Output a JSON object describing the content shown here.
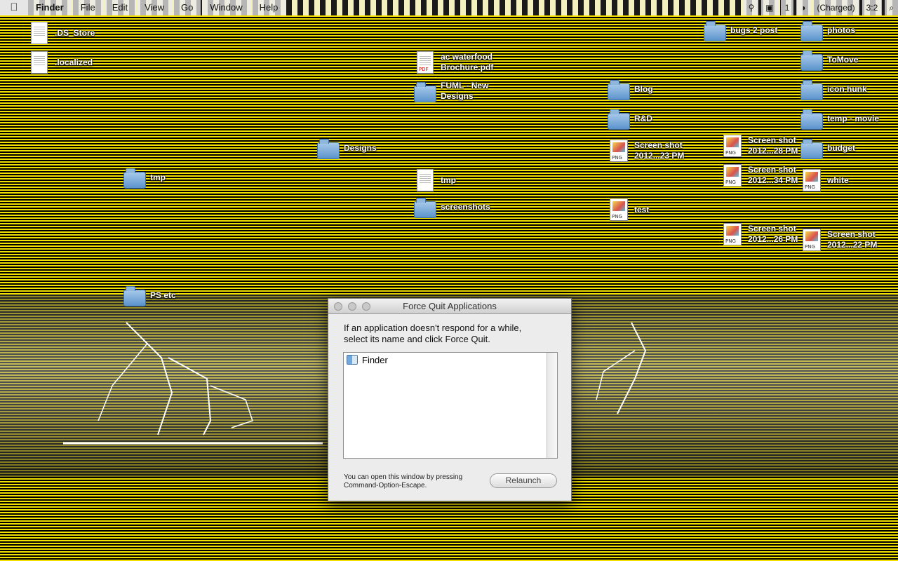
{
  "menubar": {
    "apple_icon": "apple-icon",
    "items": [
      "Finder",
      "File",
      "Edit",
      "View",
      "Go",
      "Window",
      "Help"
    ],
    "status": {
      "keyboard": "1",
      "battery": "(Charged)",
      "clock": "3:2"
    }
  },
  "desktop_icons": {
    "ds_store": {
      "label": ".DS_Store"
    },
    "localized": {
      "label": ".localized"
    },
    "brochure": {
      "line1": "ac waterfood",
      "line2": "Brochure.pdf"
    },
    "new_designs": {
      "line1": "FUML - New",
      "line2": "Designs"
    },
    "designs": {
      "label": "Designs"
    },
    "tmp_left": {
      "label": "tmp"
    },
    "tmp_doc": {
      "label": "tmp"
    },
    "screenshots": {
      "label": "screenshots"
    },
    "ps_etc": {
      "label": "PS etc"
    },
    "blog": {
      "label": "Blog"
    },
    "rnd": {
      "label": "R&D"
    },
    "screenshot_a": {
      "line1": "Screen shot",
      "line2": "2012...23 PM"
    },
    "test": {
      "label": "test"
    },
    "bugs": {
      "label": "bugs 2 post"
    },
    "screenshot_b": {
      "line1": "Screen shot",
      "line2": "2012...28 PM"
    },
    "screenshot_c": {
      "line1": "Screen shot",
      "line2": "2012...34 PM"
    },
    "screenshot_d": {
      "line1": "Screen shot",
      "line2": "2012...26 PM"
    },
    "photos": {
      "label": "photos"
    },
    "tomove": {
      "label": "ToMove"
    },
    "icon_hunk": {
      "label": "icon hunk"
    },
    "temp_movie": {
      "label": "temp - movie"
    },
    "budget": {
      "label": "budget"
    },
    "white": {
      "label": "white"
    },
    "screenshot_e": {
      "line1": "Screen shot",
      "line2": "2012...22 PM"
    }
  },
  "force_quit": {
    "title": "Force Quit Applications",
    "intro_line1": "If an application doesn't respond for a while,",
    "intro_line2": "select its name and click Force Quit.",
    "apps": [
      "Finder"
    ],
    "hint_line1": "You can open this window by pressing",
    "hint_line2": "Command-Option-Escape.",
    "button": "Relaunch"
  }
}
